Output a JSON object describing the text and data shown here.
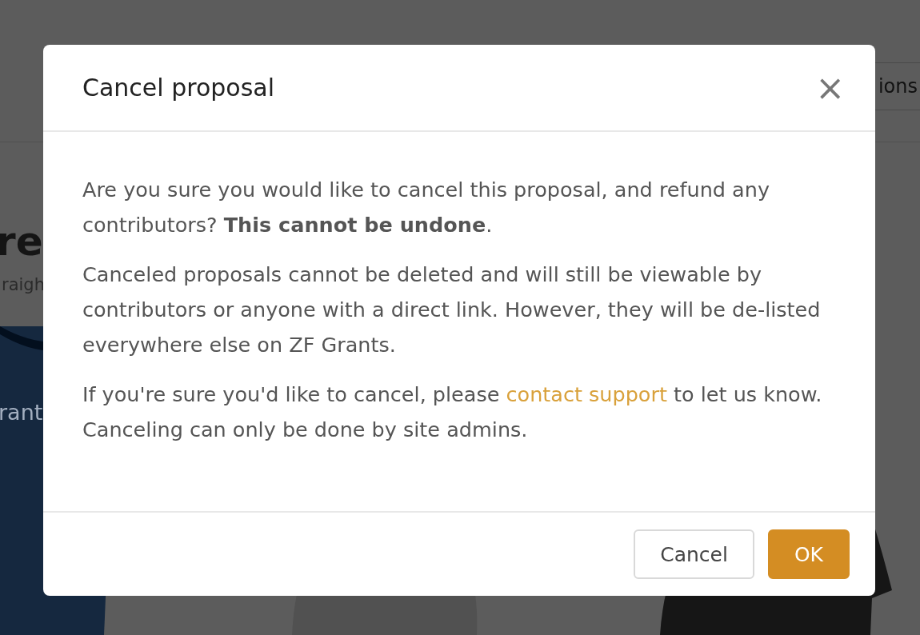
{
  "background": {
    "header_button": "ions",
    "hero_title": "re",
    "hero_subtitle": "raigh",
    "card_text": "rant"
  },
  "dialog": {
    "title": "Cancel proposal",
    "close": "×",
    "paragraphs": [
      {
        "kind": "text",
        "text": "Are you sure you would like to cancel this proposal, and refund any contributors? **This cannot be undone**."
      },
      {
        "kind": "text",
        "text": "Canceled proposals cannot be deleted and will still be viewable by contributors or anyone with a direct link. However, they will be de-listed everywhere else on ZF Grants."
      },
      {
        "kind": "link",
        "before": "If you're sure you'd like to cancel, please ",
        "link": "contact support",
        "after": " to let us know. Canceling can only be done by site admins."
      }
    ],
    "buttons": [
      {
        "label": "Cancel",
        "primary": false
      },
      {
        "label": "OK",
        "primary": true
      }
    ]
  }
}
